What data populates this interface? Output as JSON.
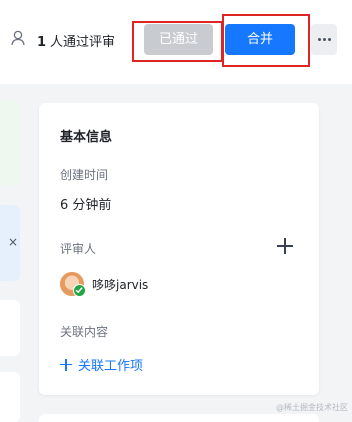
{
  "header": {
    "approval_count": "1",
    "approval_text": "人通过评审",
    "approved_button": "已通过",
    "merge_button": "合并",
    "more_icon": "more-horizontal-icon",
    "user_icon": "user-icon"
  },
  "colors": {
    "accent": "#1677ff",
    "approved_bg": "#c8ccd1",
    "highlight": "#e02424",
    "success": "#22a545"
  },
  "left_panel": {
    "close_glyph": "×"
  },
  "basic_info": {
    "title": "基本信息",
    "created_label": "创建时间",
    "created_value": "6 分钟前",
    "reviewers_label": "评审人",
    "add_reviewer_icon": "plus-icon",
    "reviewers": [
      {
        "name": "哆哆jarvis",
        "status": "approved"
      }
    ],
    "related_label": "关联内容",
    "link_work_item": "关联工作项"
  },
  "watermark": "@稀土掘金技术社区"
}
